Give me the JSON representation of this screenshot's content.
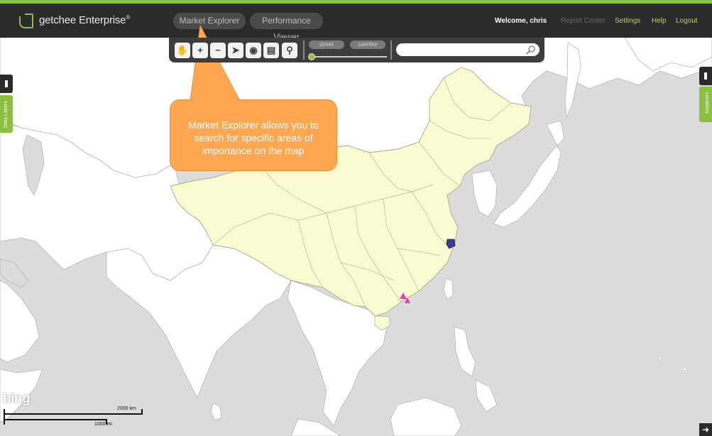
{
  "brand": {
    "name": "getchee Enterprise",
    "trademark": "®"
  },
  "tabs": [
    {
      "label": "Market Explorer"
    },
    {
      "label": "Performance Viewer"
    }
  ],
  "nav": {
    "welcome": "Welcome, chris",
    "report_center": "Report Center",
    "settings": "Settings",
    "help": "Help",
    "logout": "Logout"
  },
  "toolbar": {
    "tools": [
      {
        "icon": "pan-hand-icon",
        "glyph": "✋"
      },
      {
        "icon": "zoom-in-icon",
        "glyph": "+"
      },
      {
        "icon": "zoom-out-icon",
        "glyph": "−"
      },
      {
        "icon": "select-arrow-icon",
        "glyph": "➤"
      },
      {
        "icon": "camera-icon",
        "glyph": "◉"
      },
      {
        "icon": "print-icon",
        "glyph": "▤"
      },
      {
        "icon": "map-pin-icon",
        "glyph": "⚲"
      }
    ],
    "view_street": "street",
    "view_satellite": "satellite",
    "search_value": "",
    "search_placeholder": ""
  },
  "side_panels": {
    "left": "Data Layers",
    "right": "Locations"
  },
  "callout": {
    "text": "Market Explorer allows you to search for specific areas of importance on the map"
  },
  "map": {
    "attribution": "bing",
    "scale_km": "2000 km",
    "scale_mi": "1000 mi",
    "colors": {
      "land": "#ffffff",
      "water": "#dcdcdc",
      "highlight_region": "#fbfbd2",
      "border": "#b5b5b5",
      "accent": "#8cbf3f",
      "callout": "#ffa750"
    }
  }
}
